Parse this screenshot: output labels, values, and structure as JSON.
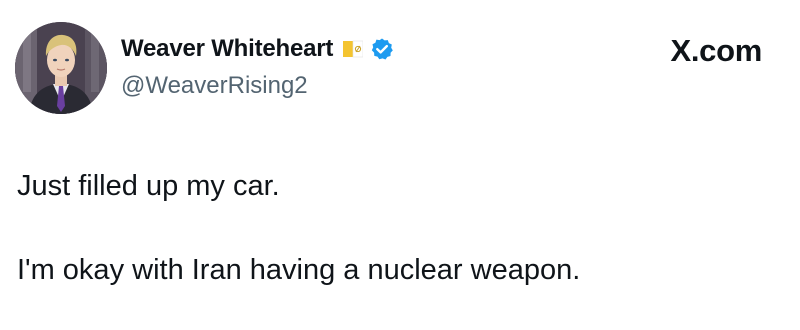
{
  "tweet": {
    "display_name": "Weaver Whiteheart",
    "handle": "@WeaverRising2",
    "site": "X.com",
    "lines": [
      "Just filled up my car.",
      "I'm okay with Iran having a nuclear weapon."
    ]
  },
  "icons": {
    "flag": "vatican-flag-icon",
    "verified": "verified-badge-icon"
  },
  "colors": {
    "verified_blue": "#1d9bf0",
    "text_primary": "#0f1419",
    "text_secondary": "#536471",
    "background": "#ffffff"
  }
}
